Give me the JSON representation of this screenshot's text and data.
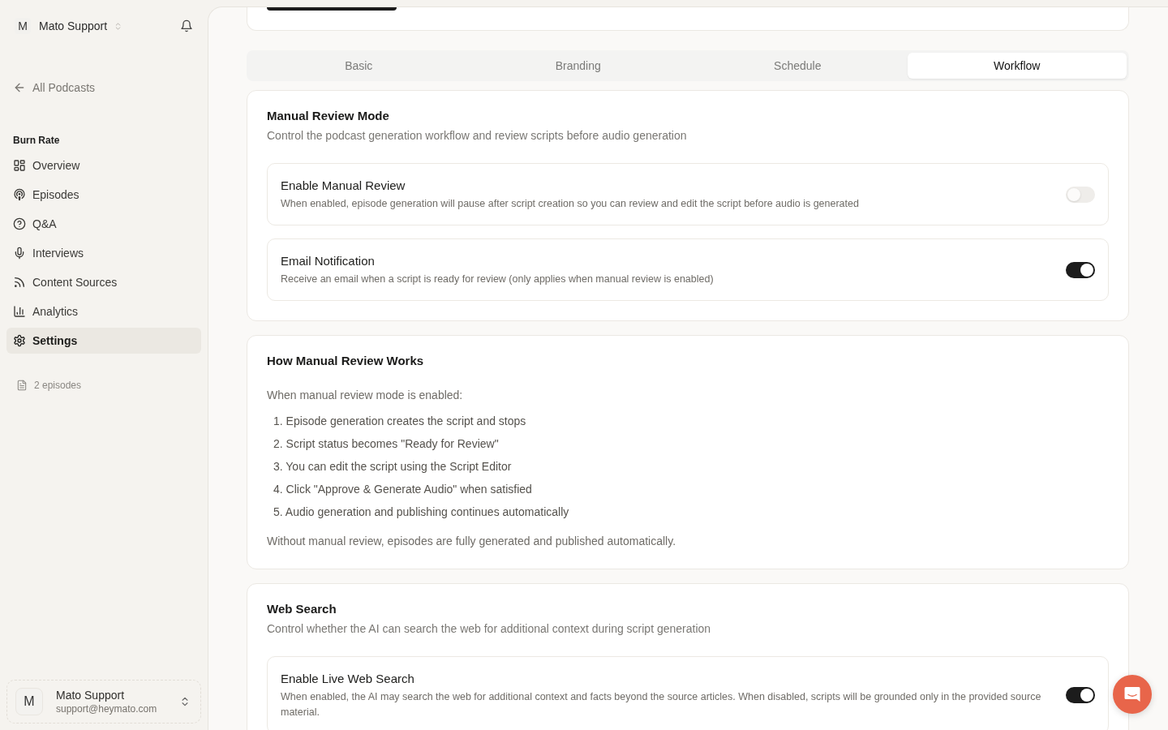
{
  "sidebar": {
    "workspace": {
      "avatar": "M",
      "name": "Mato Support"
    },
    "back_link": "All Podcasts",
    "podcast": "Burn Rate",
    "nav_items": [
      {
        "label": "Overview",
        "selected": false
      },
      {
        "label": "Episodes",
        "selected": false
      },
      {
        "label": "Q&A",
        "selected": false
      },
      {
        "label": "Interviews",
        "selected": false
      },
      {
        "label": "Content Sources",
        "selected": false
      },
      {
        "label": "Analytics",
        "selected": false
      },
      {
        "label": "Settings",
        "selected": true
      }
    ],
    "episode_count": "2 episodes",
    "user": {
      "avatar": "M",
      "name": "Mato Support",
      "email": "support@heymato.com"
    }
  },
  "tabs": [
    {
      "label": "Basic",
      "selected": false
    },
    {
      "label": "Branding",
      "selected": false
    },
    {
      "label": "Schedule",
      "selected": false
    },
    {
      "label": "Workflow",
      "selected": true
    }
  ],
  "manual_review": {
    "title": "Manual Review Mode",
    "description": "Control the podcast generation workflow and review scripts before audio generation",
    "settings": [
      {
        "title": "Enable Manual Review",
        "description": "When enabled, episode generation will pause after script creation so you can review and edit the script before audio is generated",
        "on": false
      },
      {
        "title": "Email Notification",
        "description": "Receive an email when a script is ready for review (only applies when manual review is enabled)",
        "on": true
      }
    ]
  },
  "how_it_works": {
    "title": "How Manual Review Works",
    "intro": "When manual review mode is enabled:",
    "steps": [
      "1. Episode generation creates the script and stops",
      "2. Script status becomes \"Ready for Review\"",
      "3. You can edit the script using the Script Editor",
      "4. Click \"Approve & Generate Audio\" when satisfied",
      "5. Audio generation and publishing continues automatically"
    ],
    "note": "Without manual review, episodes are fully generated and published automatically."
  },
  "web_search": {
    "title": "Web Search",
    "description": "Control whether the AI can search the web for additional context during script generation",
    "settings": [
      {
        "title": "Enable Live Web Search",
        "description": "When enabled, the AI may search the web for additional context and facts beyond the source articles. When disabled, scripts will be grounded only in the provided source material.",
        "on": true
      }
    ]
  }
}
